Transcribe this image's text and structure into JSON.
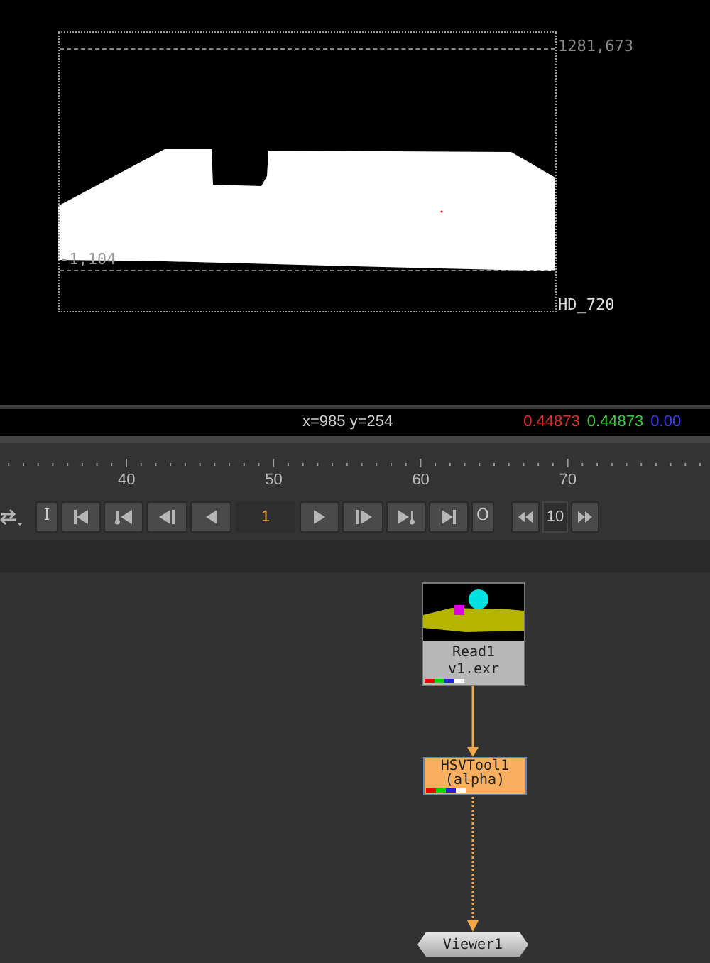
{
  "viewer": {
    "top_right_coords": "1281,673",
    "bottom_left_coords": "-1,104",
    "format_label": "HD_720"
  },
  "info_bar": {
    "cursor": "x=985 y=254",
    "pixel_values": [
      {
        "text": "0.44873",
        "color": "#e0302a"
      },
      {
        "text": "0.44873",
        "color": "#3ccf3c"
      },
      {
        "text": "0.00",
        "color": "#3a3ae8"
      }
    ]
  },
  "timeline": {
    "ticks": [
      {
        "label": "40"
      },
      {
        "label": "50"
      },
      {
        "label": "60"
      },
      {
        "label": "70"
      }
    ]
  },
  "transport": {
    "buttons": [
      {
        "kind": "text",
        "label": "I"
      },
      {
        "kind": "first"
      },
      {
        "kind": "key_prev"
      },
      {
        "kind": "step_back"
      },
      {
        "kind": "play_back"
      },
      {
        "kind": "frame",
        "label": "1"
      },
      {
        "kind": "play"
      },
      {
        "kind": "step_forward"
      },
      {
        "kind": "key_next"
      },
      {
        "kind": "last"
      },
      {
        "kind": "text",
        "label": "O"
      }
    ],
    "increment": "10"
  },
  "nodes": [
    {
      "kind": "read",
      "name": "Read1",
      "file": "v1.exr"
    },
    {
      "kind": "op",
      "name": "HSVTool1",
      "mask": "(alpha)"
    },
    {
      "kind": "viewer",
      "name": "Viewer1"
    }
  ]
}
